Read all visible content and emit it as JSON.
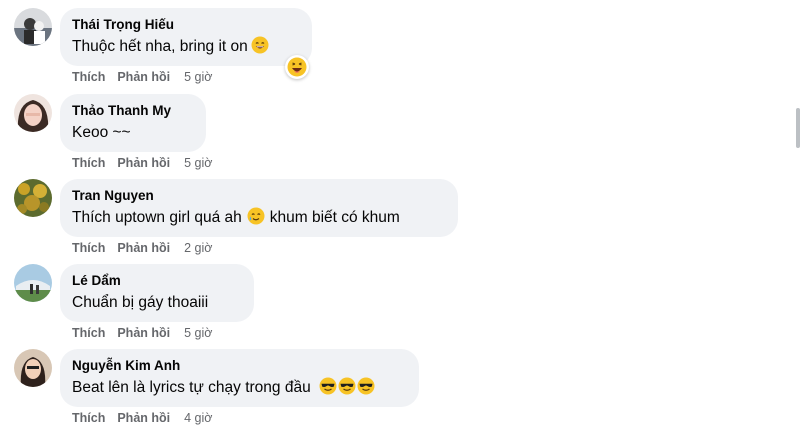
{
  "actions": {
    "like": "Thích",
    "reply": "Phản hồi"
  },
  "comments": [
    {
      "author": "Thái Trọng Hiếu",
      "text": "Thuộc hết nha, bring it on",
      "emojis": [
        "grin-emoji"
      ],
      "reaction": "laughing-reaction",
      "time": "5 giờ"
    },
    {
      "author": "Thảo Thanh My",
      "text": "Keoo ~~",
      "time": "5 giờ"
    },
    {
      "author": "Tran Nguyen",
      "text_before": "Thích uptown girl quá ah",
      "text_after": "khum biết có khum",
      "emojis": [
        "tear-smile-emoji"
      ],
      "time": "2 giờ"
    },
    {
      "author": "Lé Dẩm",
      "text": "Chuẩn bị gáy thoaiii",
      "time": "5 giờ"
    },
    {
      "author": "Nguyễn Kim Anh",
      "text": "Beat lên là lyrics tự chạy trong đầu",
      "emojis": [
        "sunglasses-emoji",
        "sunglasses-emoji",
        "sunglasses-emoji"
      ],
      "time": "4 giờ"
    }
  ],
  "colors": {
    "bubble": "#f0f2f5",
    "meta": "#65676b",
    "emoji": "#f7c325"
  }
}
